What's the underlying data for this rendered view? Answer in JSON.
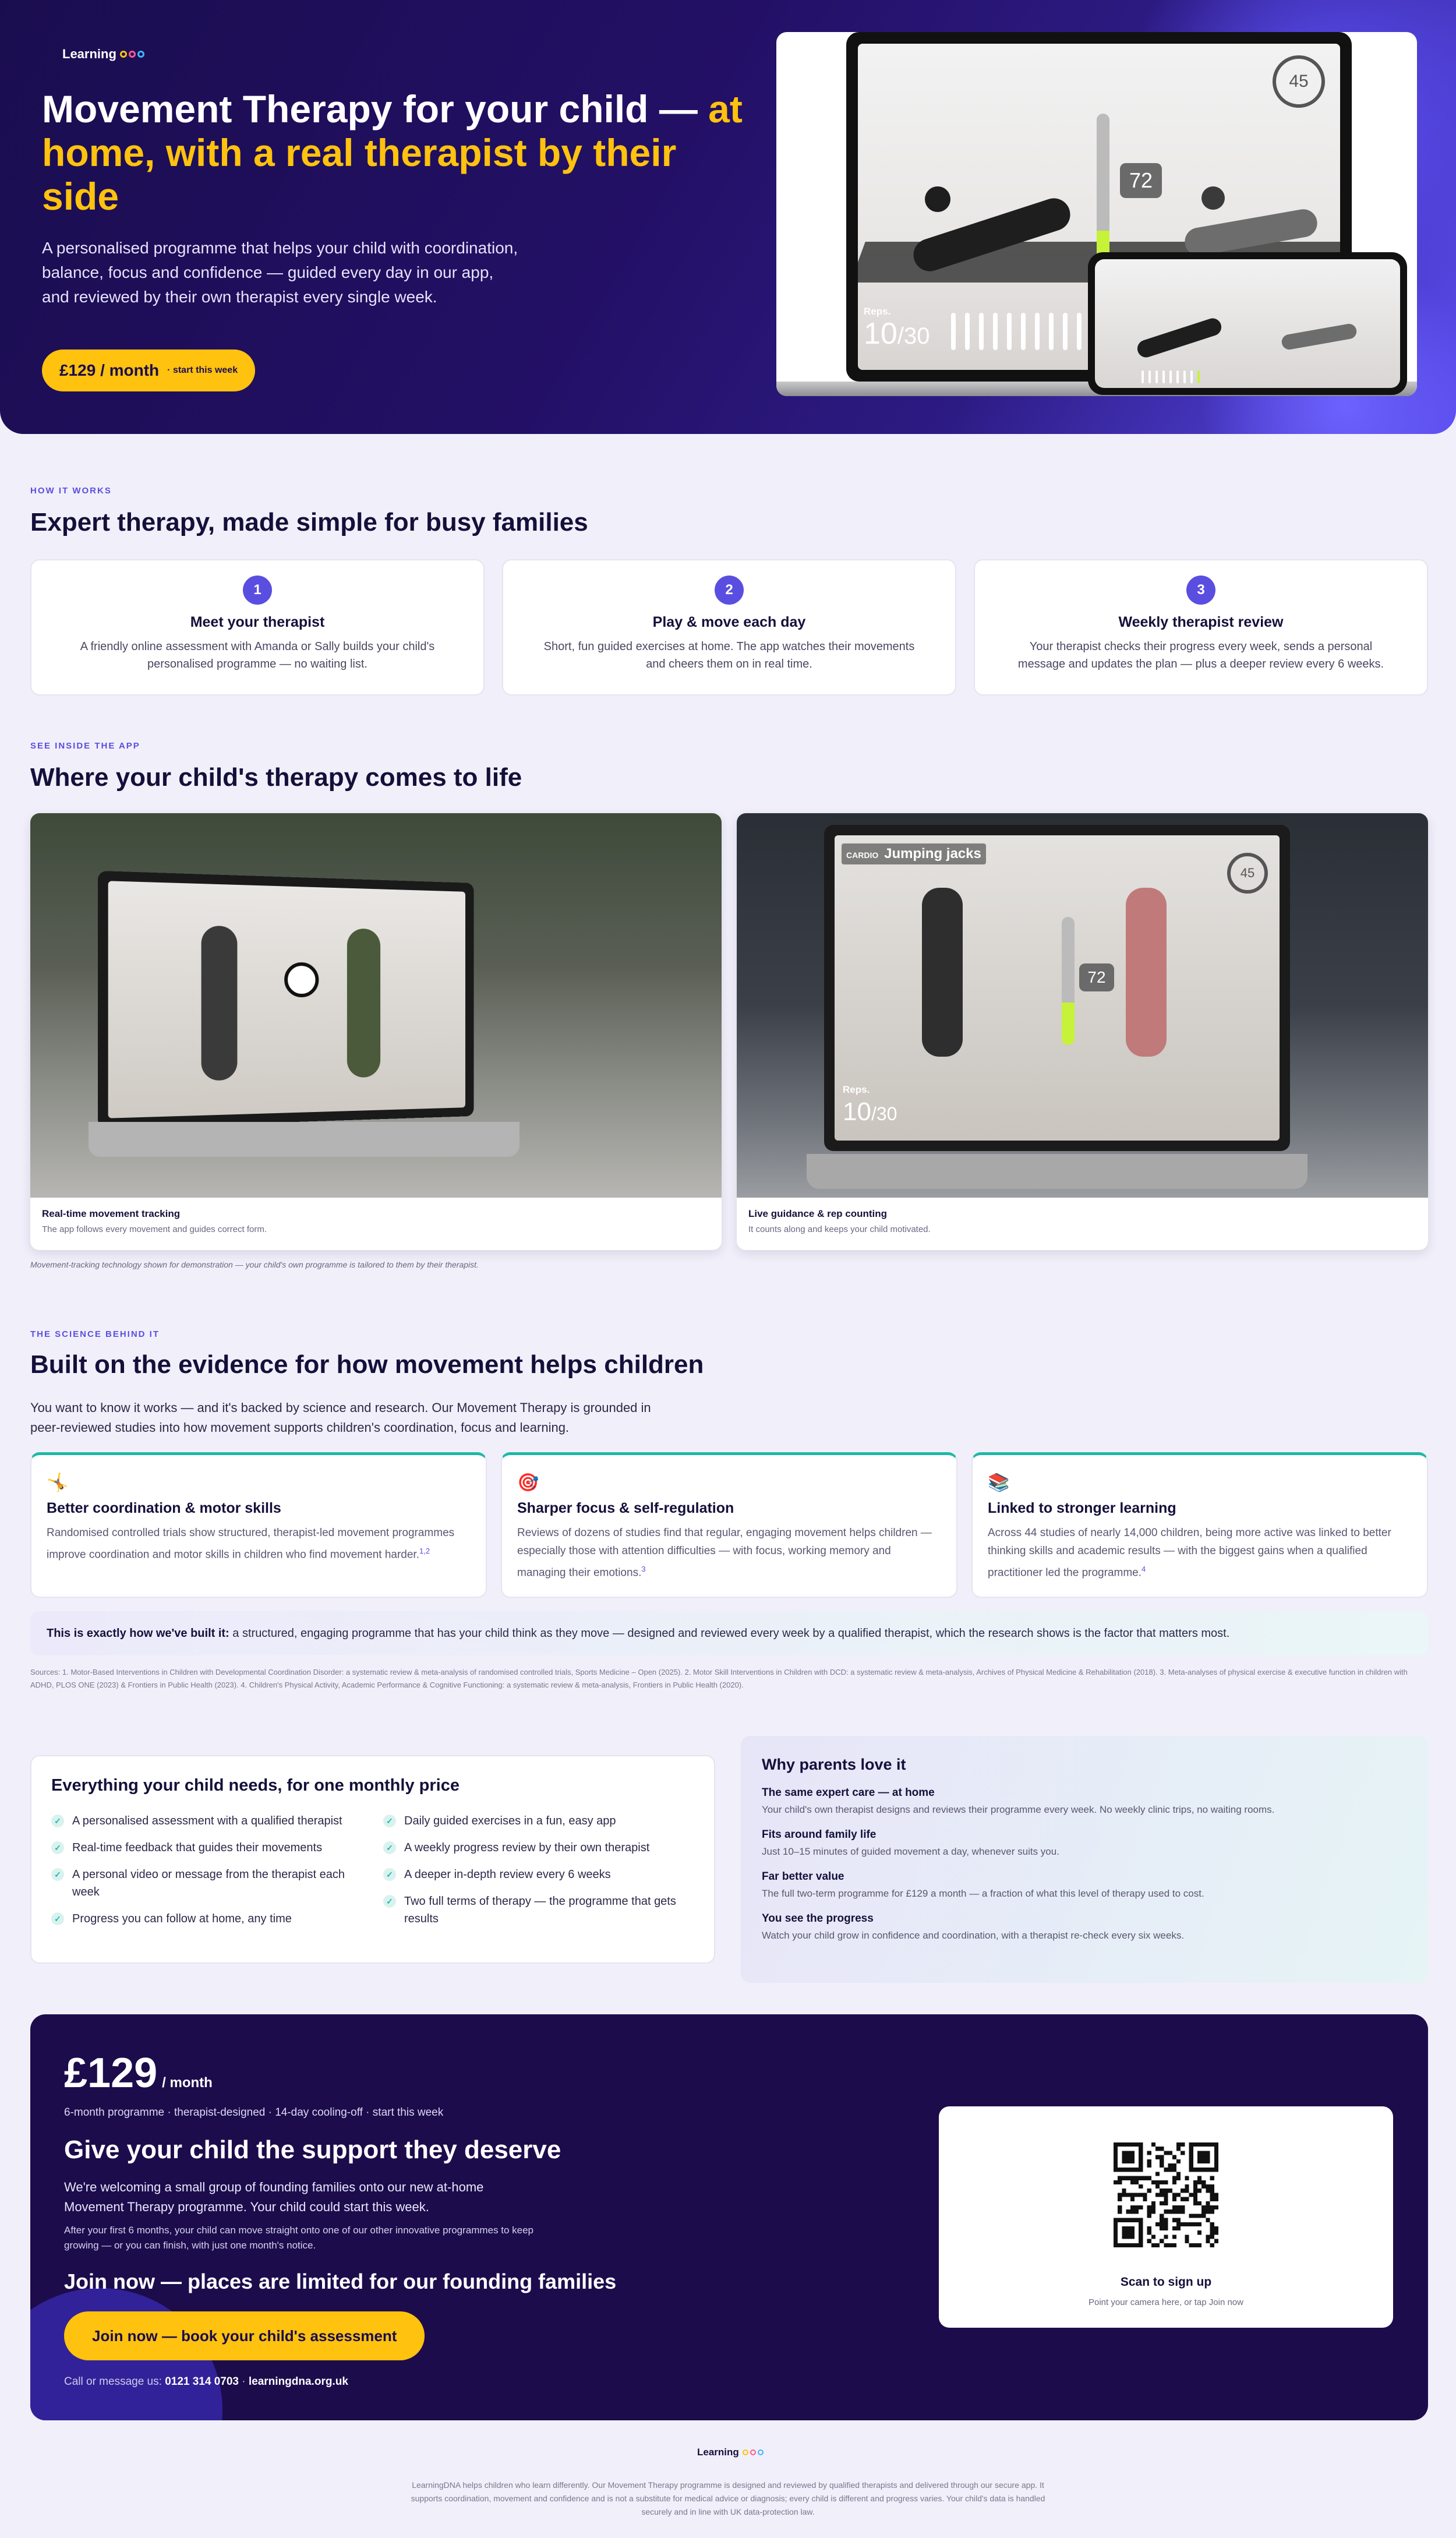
{
  "brand": {
    "name": "Learning",
    "dot_colors": [
      "#ffc20e",
      "#ff5a8a",
      "#3fb4ff"
    ]
  },
  "colors": {
    "navy": "#1c0c4c",
    "accent": "#ffc20e",
    "purple": "#5a4ee0",
    "teal": "#1fb8a8"
  },
  "hero": {
    "title_main": "Movement Therapy for your child — ",
    "title_highlight": "at home, with a real therapist by their side",
    "lead": "A personalised programme that helps your child with coordination, balance, focus and confidence — guided every day in our app, and reviewed by their own therapist every single week.",
    "price_label": "£129 / month",
    "price_sub": "· start this week",
    "screen": {
      "timer": "45",
      "rep_count": "72",
      "reps_label": "Reps.",
      "reps_value": "10",
      "reps_total": "/30",
      "rep_progress": 0.33
    }
  },
  "how": {
    "kicker": "HOW IT WORKS",
    "title": "Expert therapy, made simple for busy families",
    "steps": [
      {
        "num": "1",
        "title": "Meet your therapist",
        "desc": "A friendly online assessment with Amanda or Sally builds your child's personalised programme — no waiting list."
      },
      {
        "num": "2",
        "title": "Play & move each day",
        "desc": "Short, fun guided exercises at home. The app watches their movements and cheers them on in real time."
      },
      {
        "num": "3",
        "title": "Weekly therapist review",
        "desc": "Your therapist checks their progress every week, sends a personal message and updates the plan — plus a deeper review every 6 weeks."
      }
    ]
  },
  "app": {
    "kicker": "SEE INSIDE THE APP",
    "title": "Where your child's therapy comes to life",
    "cards": [
      {
        "title": "Real-time movement tracking",
        "desc": "The app follows every movement and guides correct form."
      },
      {
        "title": "Live guidance & rep counting",
        "desc": "It counts along and keeps your child motivated.",
        "screen_category": "CARDIO",
        "screen_title": "Jumping jacks",
        "timer": "45",
        "rep_count": "72",
        "reps_label": "Reps.",
        "reps_value": "10",
        "reps_total": "/30"
      }
    ],
    "note": "Movement-tracking technology shown for demonstration — your child's own programme is tailored to them by their therapist."
  },
  "science": {
    "kicker": "THE SCIENCE BEHIND IT",
    "title": "Built on the evidence for how movement helps children",
    "intro": "You want to know it works — and it's backed by science and research. Our Movement Therapy is grounded in peer-reviewed studies into how movement supports children's coordination, focus and learning.",
    "cards": [
      {
        "icon": "🤸",
        "icon_name": "gymnast-icon",
        "title": "Better coordination & motor skills",
        "desc": "Randomised controlled trials show structured, therapist-led movement programmes improve coordination and motor skills in children who find movement harder.",
        "ref": "1,2"
      },
      {
        "icon": "🎯",
        "icon_name": "target-icon",
        "title": "Sharper focus & self-regulation",
        "desc": "Reviews of dozens of studies find that regular, engaging movement helps children — especially those with attention difficulties — with focus, working memory and managing their emotions.",
        "ref": "3"
      },
      {
        "icon": "📚",
        "icon_name": "books-icon",
        "title": "Linked to stronger learning",
        "desc": "Across 44 studies of nearly 14,000 children, being more active was linked to better thinking skills and academic results — with the biggest gains when a qualified practitioner led the programme.",
        "ref": "4"
      }
    ],
    "built_bold": "This is exactly how we've built it:",
    "built_text": " a structured, engaging programme that has your child think as they move — designed and reviewed every week by a qualified therapist, which the research shows is the factor that matters most.",
    "sources": "Sources: 1. Motor-Based Interventions in Children with Developmental Coordination Disorder: a systematic review & meta-analysis of randomised controlled trials, Sports Medicine – Open (2025).   2. Motor Skill Interventions in Children with DCD: a systematic review & meta-analysis, Archives of Physical Medicine & Rehabilitation (2018).   3. Meta-analyses of physical exercise & executive function in children with ADHD, PLOS ONE (2023) & Frontiers in Public Health (2023).   4. Children's Physical Activity, Academic Performance & Cognitive Functioning: a systematic review & meta-analysis, Frontiers in Public Health (2020)."
  },
  "needs": {
    "title": "Everything your child needs, for one monthly price",
    "col1": [
      "A personalised assessment with a qualified therapist",
      "Real-time feedback that guides their movements",
      "A personal video or message from the therapist each week",
      "Progress you can follow at home, any time"
    ],
    "col2": [
      "Daily guided exercises in a fun, easy app",
      "A weekly progress review by their own therapist",
      "A deeper in-depth review every 6 weeks",
      "Two full terms of therapy — the programme that gets results"
    ]
  },
  "parents": {
    "title": "Why parents love it",
    "items": [
      {
        "title": "The same expert care — at home",
        "desc": "Your child's own therapist designs and reviews their programme every week. No weekly clinic trips, no waiting rooms."
      },
      {
        "title": "Fits around family life",
        "desc": "Just 10–15 minutes of guided movement a day, whenever suits you."
      },
      {
        "title": "Far better value",
        "desc": "The full two-term programme for £129 a month — a fraction of what this level of therapy used to cost."
      },
      {
        "title": "You see the progress",
        "desc": "Watch your child grow in confidence and coordination, with a therapist re-check every six weeks."
      }
    ]
  },
  "pricing": {
    "price": "£129",
    "per": "/ month",
    "meta": "6-month programme · therapist-designed · 14-day cooling-off · start this week",
    "title": "Give your child the support they deserve",
    "p1": "We're welcoming a small group of founding families onto our new at-home Movement Therapy programme. Your child could start this week.",
    "p2": "After your first 6 months, your child can move straight onto one of our other innovative programmes to keep growing — or you can finish, with just one month's notice.",
    "limited": "Join now — places are limited for our founding families",
    "cta": "Join now — book your child's assessment",
    "contact_label": "Call or message us: ",
    "phone": "0121 314 0703",
    "sep": " · ",
    "site": "learningdna.org.uk",
    "qr_title": "Scan to sign up",
    "qr_desc": "Point your camera here, or tap Join now"
  },
  "footer": {
    "text": "LearningDNA helps children who learn differently. Our Movement Therapy programme is designed and reviewed by qualified therapists and delivered through our secure app. It supports coordination, movement and confidence and is not a substitute for medical advice or diagnosis; every child is different and progress varies. Your child's data is handled securely and in line with UK data-protection law."
  }
}
